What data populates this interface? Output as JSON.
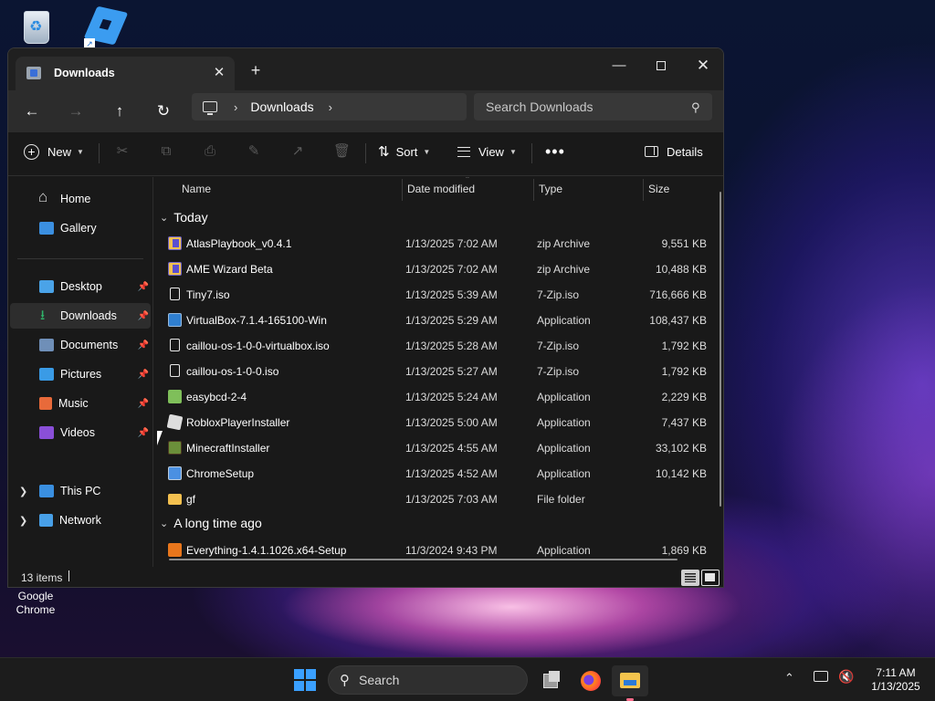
{
  "desktop": {
    "icons": [
      {
        "name": "Recycle Bin",
        "icon": "recycle-bin-icon"
      },
      {
        "name": "Roblox Player",
        "icon": "roblox-icon"
      },
      {
        "name": "Google Chrome",
        "label_lines": [
          "Google",
          "Chrome"
        ],
        "icon": "chrome-icon"
      }
    ]
  },
  "window": {
    "tab_title": "Downloads",
    "controls": {
      "close_tab": "✕",
      "new_tab": "+",
      "minimize": "—",
      "maximize": "",
      "close": "✕"
    }
  },
  "address": {
    "back": "←",
    "forward": "→",
    "up": "↑",
    "refresh": "↻",
    "breadcrumb": [
      "Downloads"
    ],
    "chevron": "›",
    "search_placeholder": "Search Downloads"
  },
  "toolbar": {
    "new_label": "New",
    "sort_label": "Sort",
    "view_label": "View",
    "more_label": "•••",
    "details_label": "Details",
    "disabled_actions": [
      "cut",
      "copy",
      "paste",
      "rename",
      "share",
      "delete"
    ]
  },
  "nav": {
    "quick": [
      {
        "label": "Home",
        "icon": "home-icon"
      },
      {
        "label": "Gallery",
        "icon": "gallery-icon"
      }
    ],
    "pinned": [
      {
        "label": "Desktop",
        "icon": "desktop-icon"
      },
      {
        "label": "Downloads",
        "icon": "downloads-icon",
        "selected": true
      },
      {
        "label": "Documents",
        "icon": "documents-icon"
      },
      {
        "label": "Pictures",
        "icon": "pictures-icon"
      },
      {
        "label": "Music",
        "icon": "music-icon"
      },
      {
        "label": "Videos",
        "icon": "videos-icon"
      }
    ],
    "locations": [
      {
        "label": "This PC",
        "icon": "this-pc-icon"
      },
      {
        "label": "Network",
        "icon": "network-icon"
      }
    ],
    "pin_glyph": "📌"
  },
  "columns": {
    "name": "Name",
    "date": "Date modified",
    "type": "Type",
    "size": "Size"
  },
  "groups": [
    {
      "title": "Today",
      "files": [
        {
          "name": "AtlasPlaybook_v0.4.1",
          "date": "1/13/2025 7:02 AM",
          "type": "zip Archive",
          "size": "9,551 KB",
          "icon": "zip-archive-icon"
        },
        {
          "name": "AME Wizard Beta",
          "date": "1/13/2025 7:02 AM",
          "type": "zip Archive",
          "size": "10,488 KB",
          "icon": "zip-archive-icon"
        },
        {
          "name": "Tiny7.iso",
          "date": "1/13/2025 5:39 AM",
          "type": "7-Zip.iso",
          "size": "716,666 KB",
          "icon": "iso-file-icon"
        },
        {
          "name": "VirtualBox-7.1.4-165100-Win",
          "date": "1/13/2025 5:29 AM",
          "type": "Application",
          "size": "108,437 KB",
          "icon": "virtualbox-icon"
        },
        {
          "name": "caillou-os-1-0-0-virtualbox.iso",
          "date": "1/13/2025 5:28 AM",
          "type": "7-Zip.iso",
          "size": "1,792 KB",
          "icon": "iso-file-icon"
        },
        {
          "name": "caillou-os-1-0-0.iso",
          "date": "1/13/2025 5:27 AM",
          "type": "7-Zip.iso",
          "size": "1,792 KB",
          "icon": "iso-file-icon"
        },
        {
          "name": "easybcd-2-4",
          "date": "1/13/2025 5:24 AM",
          "type": "Application",
          "size": "2,229 KB",
          "icon": "easybcd-icon"
        },
        {
          "name": "RobloxPlayerInstaller",
          "date": "1/13/2025 5:00 AM",
          "type": "Application",
          "size": "7,437 KB",
          "icon": "roblox-installer-icon"
        },
        {
          "name": "MinecraftInstaller",
          "date": "1/13/2025 4:55 AM",
          "type": "Application",
          "size": "33,102 KB",
          "icon": "minecraft-icon"
        },
        {
          "name": "ChromeSetup",
          "date": "1/13/2025 4:52 AM",
          "type": "Application",
          "size": "10,142 KB",
          "icon": "chrome-setup-icon"
        },
        {
          "name": "gf",
          "date": "1/13/2025 7:03 AM",
          "type": "File folder",
          "size": "",
          "icon": "folder-icon"
        }
      ]
    },
    {
      "title": "A long time ago",
      "files": [
        {
          "name": "Everything-1.4.1.1026.x64-Setup",
          "date": "11/3/2024 9:43 PM",
          "type": "Application",
          "size": "1,869 KB",
          "icon": "everything-icon"
        }
      ]
    }
  ],
  "status": {
    "count": "13 items"
  },
  "taskbar": {
    "search_label": "Search",
    "apps": [
      "task-view-icon",
      "firefox-icon",
      "file-explorer-icon"
    ],
    "time": "7:11 AM",
    "date": "1/13/2025"
  }
}
